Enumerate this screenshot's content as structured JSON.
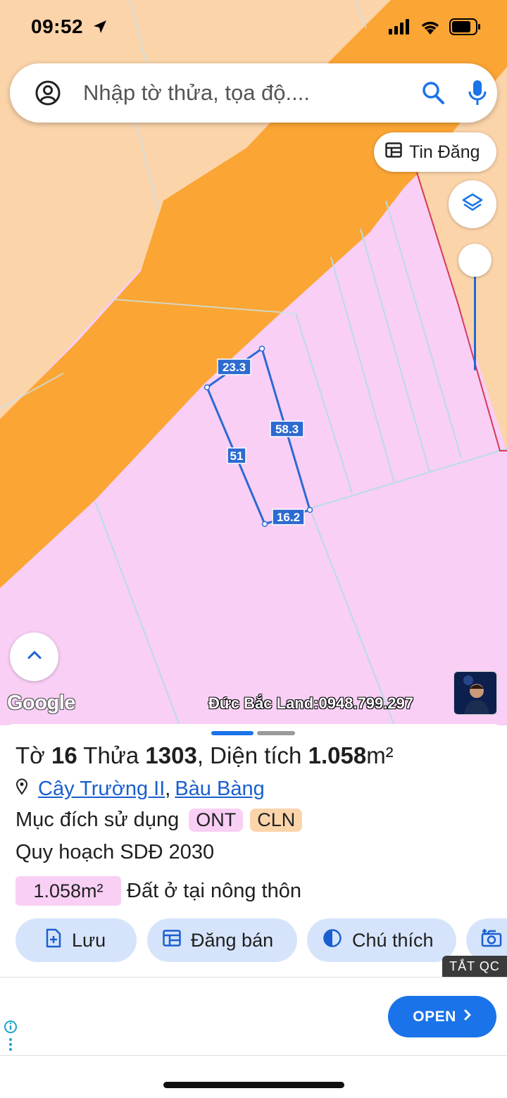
{
  "status_bar": {
    "time": "09:52"
  },
  "search": {
    "placeholder": "Nhập tờ thửa, tọa độ...."
  },
  "tin_dang": {
    "label": "Tin Đăng"
  },
  "map": {
    "plot_edges": [
      "23.3",
      "58.3",
      "51",
      "16.2"
    ],
    "google_label": "Google",
    "watermark": "Đức Bắc Land:0948.799.297",
    "colors": {
      "residential": "#f9cff5",
      "perennial": "#fbd4aa",
      "road": "#fba534",
      "edge": "#2d6ad1"
    }
  },
  "parcel": {
    "title_sheet_label": "Tờ",
    "sheet_number": "16",
    "title_parcel_label": "Thửa",
    "parcel_number": "1303",
    "title_area_label": ", Diện tích",
    "area_value": "1.058",
    "area_unit": "m²",
    "location": {
      "ward": "Cây Trường II",
      "separator": ",",
      "district": "Bàu Bàng"
    },
    "purpose_label": "Mục đích sử dụng",
    "purpose_badges": [
      {
        "code": "ONT",
        "color": "#f9cff5"
      },
      {
        "code": "CLN",
        "color": "#fbd4aa"
      }
    ],
    "plan_label": "Quy hoạch SDĐ 2030",
    "plan_area": "1.058m²",
    "plan_area_color": "#f9cff5",
    "plan_desc": "Đất ở tại nông thôn"
  },
  "actions": [
    {
      "label": "Lưu",
      "icon": "save-icon"
    },
    {
      "label": "Đăng bán",
      "icon": "post-icon"
    },
    {
      "label": "Chú thích",
      "icon": "legend-icon"
    },
    {
      "label": "",
      "icon": "camera-icon"
    }
  ],
  "ad": {
    "hide_label": "TẮT QC",
    "open_label": "OPEN"
  }
}
